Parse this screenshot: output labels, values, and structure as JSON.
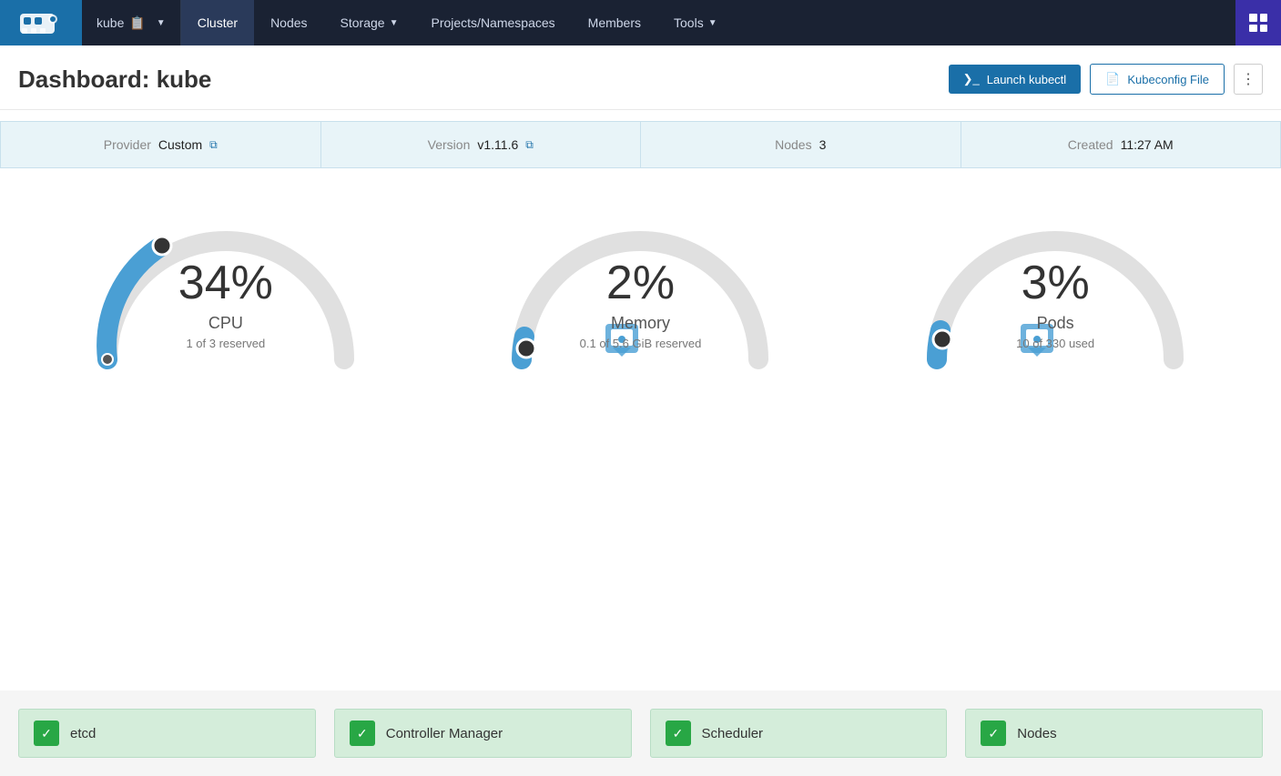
{
  "navbar": {
    "brand": "kube",
    "cluster_label": "kube",
    "cluster_icon": "📋",
    "nav_items": [
      {
        "label": "Cluster",
        "active": true,
        "dropdown": false
      },
      {
        "label": "Nodes",
        "active": false,
        "dropdown": false
      },
      {
        "label": "Storage",
        "active": false,
        "dropdown": true
      },
      {
        "label": "Projects/Namespaces",
        "active": false,
        "dropdown": false
      },
      {
        "label": "Members",
        "active": false,
        "dropdown": false
      },
      {
        "label": "Tools",
        "active": false,
        "dropdown": true
      }
    ]
  },
  "page": {
    "title_prefix": "Dashboard:",
    "title_cluster": "kube",
    "btn_kubectl": "Launch kubectl",
    "btn_kubeconfig": "Kubeconfig File",
    "btn_more": "⋮"
  },
  "info_bar": {
    "provider_label": "Provider",
    "provider_value": "Custom",
    "version_label": "Version",
    "version_value": "v1.11.6",
    "nodes_label": "Nodes",
    "nodes_value": "3",
    "created_label": "Created",
    "created_value": "11:27 AM"
  },
  "gauges": [
    {
      "id": "cpu",
      "percent": "34%",
      "label": "CPU",
      "sublabel": "1 of 3 reserved",
      "value": 34,
      "color": "#4a9fd4"
    },
    {
      "id": "memory",
      "percent": "2%",
      "label": "Memory",
      "sublabel": "0.1 of 5.6 GiB reserved",
      "value": 2,
      "color": "#4a9fd4"
    },
    {
      "id": "pods",
      "percent": "3%",
      "label": "Pods",
      "sublabel": "10 of 330 used",
      "value": 3,
      "color": "#4a9fd4"
    }
  ],
  "status_items": [
    {
      "id": "etcd",
      "label": "etcd",
      "ok": true
    },
    {
      "id": "controller-manager",
      "label": "Controller Manager",
      "ok": true
    },
    {
      "id": "scheduler",
      "label": "Scheduler",
      "ok": true
    },
    {
      "id": "nodes",
      "label": "Nodes",
      "ok": true
    }
  ]
}
